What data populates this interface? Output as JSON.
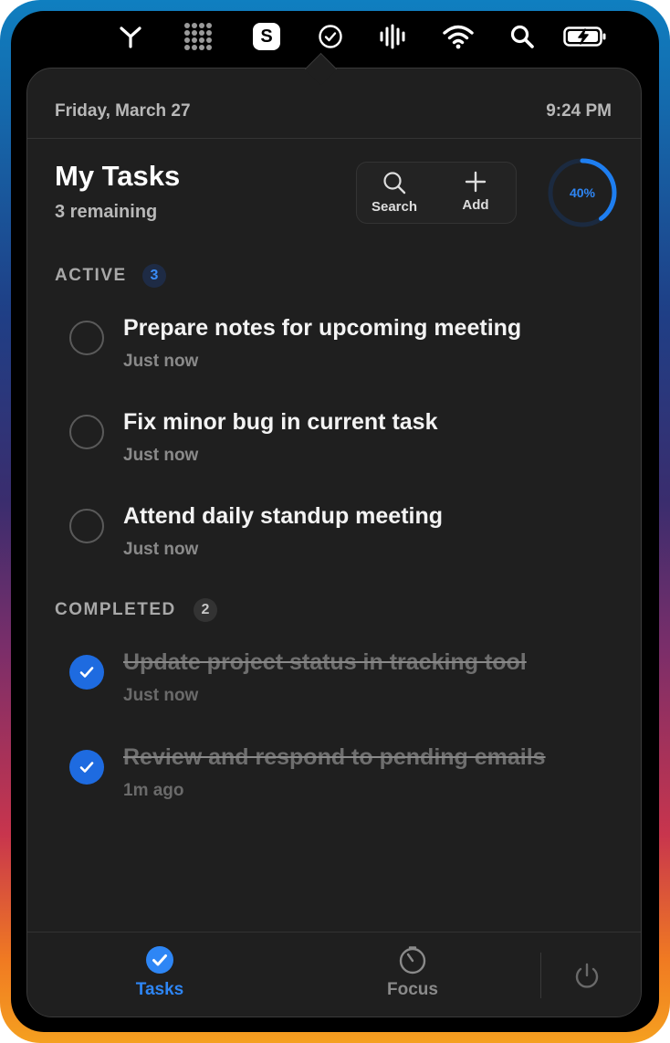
{
  "menubar": {
    "icons": [
      "y-logo-icon",
      "grid-dots-icon",
      "skype-s-icon",
      "tasks-check-icon",
      "waveform-icon",
      "wifi-icon",
      "search-icon",
      "battery-charging-icon"
    ],
    "skype_letter": "S"
  },
  "header": {
    "date": "Friday, March 27",
    "time": "9:24 PM"
  },
  "tasks_panel": {
    "title": "My Tasks",
    "remaining": "3 remaining",
    "search_label": "Search",
    "add_label": "Add",
    "progress_label": "40%",
    "progress_fraction": 0.4
  },
  "active": {
    "label": "ACTIVE",
    "count": "3",
    "items": [
      {
        "title": "Prepare notes for upcoming meeting",
        "time": "Just now"
      },
      {
        "title": "Fix minor bug in current task",
        "time": "Just now"
      },
      {
        "title": "Attend daily standup meeting",
        "time": "Just now"
      }
    ]
  },
  "completed": {
    "label": "COMPLETED",
    "count": "2",
    "items": [
      {
        "title": "Update project status in tracking tool",
        "time": "Just now"
      },
      {
        "title": "Review and respond to pending emails",
        "time": "1m ago"
      }
    ]
  },
  "bottom_bar": {
    "tasks_label": "Tasks",
    "focus_label": "Focus"
  },
  "colors": {
    "accent": "#1e6be0",
    "panel": "#1f1f1f"
  }
}
